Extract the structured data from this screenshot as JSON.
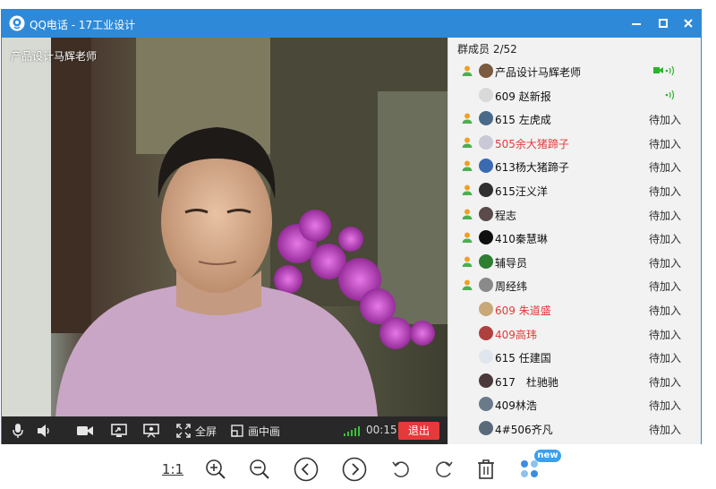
{
  "window": {
    "title": "QQ电话 - 17工业设计",
    "icon": "qq-phone-icon"
  },
  "video": {
    "caller_name": "产品设计马辉老师"
  },
  "controls": {
    "fullscreen_label": "全屏",
    "pip_label": "画中画",
    "duration": "00:15",
    "exit_label": "退出"
  },
  "panel": {
    "header": "群成员 2/52",
    "members": [
      {
        "name": "产品设计马辉老师",
        "status": "",
        "red": false,
        "avatar_color": "#7a5a40",
        "role_icon": true,
        "cam": true,
        "sound": true
      },
      {
        "name": "609 赵新报",
        "status": "",
        "red": false,
        "avatar_color": "#d9d9d9",
        "role_icon": false,
        "cam": false,
        "sound": true
      },
      {
        "name": "615 左虎成",
        "status": "待加入",
        "red": false,
        "avatar_color": "#4a6a8a",
        "role_icon": true
      },
      {
        "name": "505余大猪蹄子",
        "status": "待加入",
        "red": true,
        "avatar_color": "#c9c9d6",
        "role_icon": true
      },
      {
        "name": "613杨大猪蹄子",
        "status": "待加入",
        "red": false,
        "avatar_color": "#3a6ab0",
        "role_icon": true
      },
      {
        "name": "615汪义洋",
        "status": "待加入",
        "red": false,
        "avatar_color": "#303030",
        "role_icon": true
      },
      {
        "name": "程志",
        "status": "待加入",
        "red": false,
        "avatar_color": "#5a4a4a",
        "role_icon": true
      },
      {
        "name": "410秦慧琳",
        "status": "待加入",
        "red": false,
        "avatar_color": "#101010",
        "role_icon": true
      },
      {
        "name": "辅导员",
        "status": "待加入",
        "red": false,
        "avatar_color": "#2e7d32",
        "role_icon": true
      },
      {
        "name": "周经纬",
        "status": "待加入",
        "red": false,
        "avatar_color": "#8a8a8a",
        "role_icon": true
      },
      {
        "name": "609 朱道盛",
        "status": "待加入",
        "red": true,
        "avatar_color": "#c8a878",
        "role_icon": false
      },
      {
        "name": "409高玮",
        "status": "待加入",
        "red": true,
        "avatar_color": "#b04040",
        "role_icon": false
      },
      {
        "name": "615 任建国",
        "status": "待加入",
        "red": false,
        "avatar_color": "#dfe6ee",
        "role_icon": false
      },
      {
        "name": "617　杜驰驰",
        "status": "待加入",
        "red": false,
        "avatar_color": "#4a3a3a",
        "role_icon": false
      },
      {
        "name": "409林浩",
        "status": "待加入",
        "red": false,
        "avatar_color": "#6a7a8a",
        "role_icon": false
      },
      {
        "name": "4#506齐凡",
        "status": "待加入",
        "red": false,
        "avatar_color": "#5a6a7a",
        "role_icon": false
      }
    ]
  },
  "viewer_toolbar": {
    "ratio_label": "1:1",
    "new_badge": "new"
  },
  "colors": {
    "titlebar": "#2e8ad8",
    "exit": "#e5393a",
    "active_green": "#2ab52a",
    "red_name": "#e23b3b"
  }
}
